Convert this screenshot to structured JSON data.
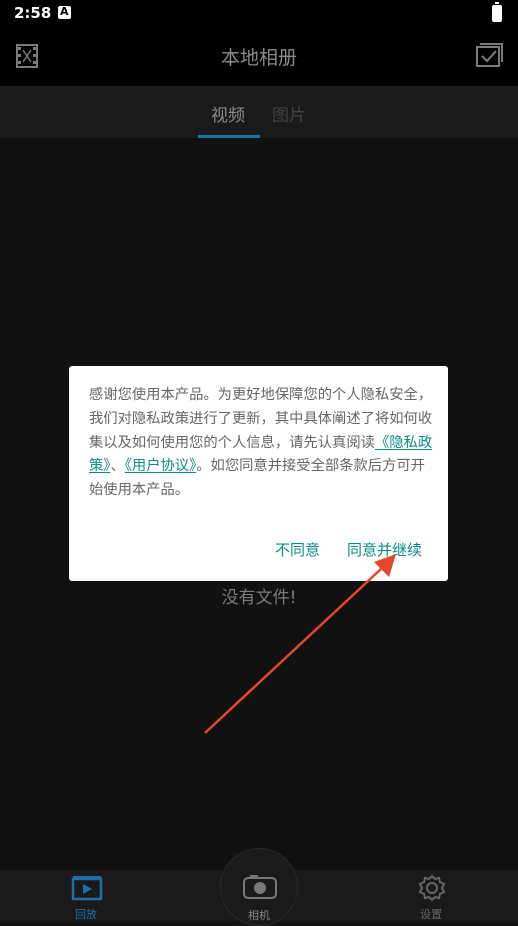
{
  "status": {
    "time": "2:58"
  },
  "header": {
    "title": "本地相册"
  },
  "tabs": [
    {
      "label": "视频",
      "active": true
    },
    {
      "label": "图片",
      "active": false
    }
  ],
  "main": {
    "empty_text": "没有文件!"
  },
  "dialog": {
    "text_part1": "感谢您使用本产品。为更好地保障您的个人隐私安全，我们对隐私政策进行了更新，其中具体阐述了将如何收集以及如何使用您的个人信息，请先认真阅读",
    "privacy_link": "《隐私政策》",
    "separator": "、",
    "terms_link": "《用户协议》",
    "text_part2": "。如您同意并接受全部条款后方可开始使用本产品。",
    "disagree_label": "不同意",
    "agree_label": "同意并继续"
  },
  "bottom_nav": [
    {
      "label": "回放",
      "icon": "playback-icon",
      "active": true
    },
    {
      "label": "相机",
      "icon": "camera-icon",
      "active": false
    },
    {
      "label": "设置",
      "icon": "settings-icon",
      "active": false
    }
  ],
  "colors": {
    "accent": "#0d8a8a",
    "tab_indicator": "#1e7fb8",
    "nav_active": "#1e6fa8",
    "annotation_arrow": "#e4472d"
  }
}
